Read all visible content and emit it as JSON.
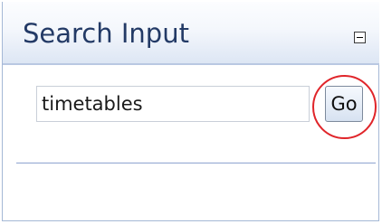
{
  "panel": {
    "title": "Search Input",
    "collapse_icon": "minus-box-icon"
  },
  "search": {
    "value": "timetables",
    "button_label": "Go"
  },
  "colors": {
    "title_text": "#233a66",
    "highlight": "#e0252a",
    "divider": "#8da4cf"
  }
}
